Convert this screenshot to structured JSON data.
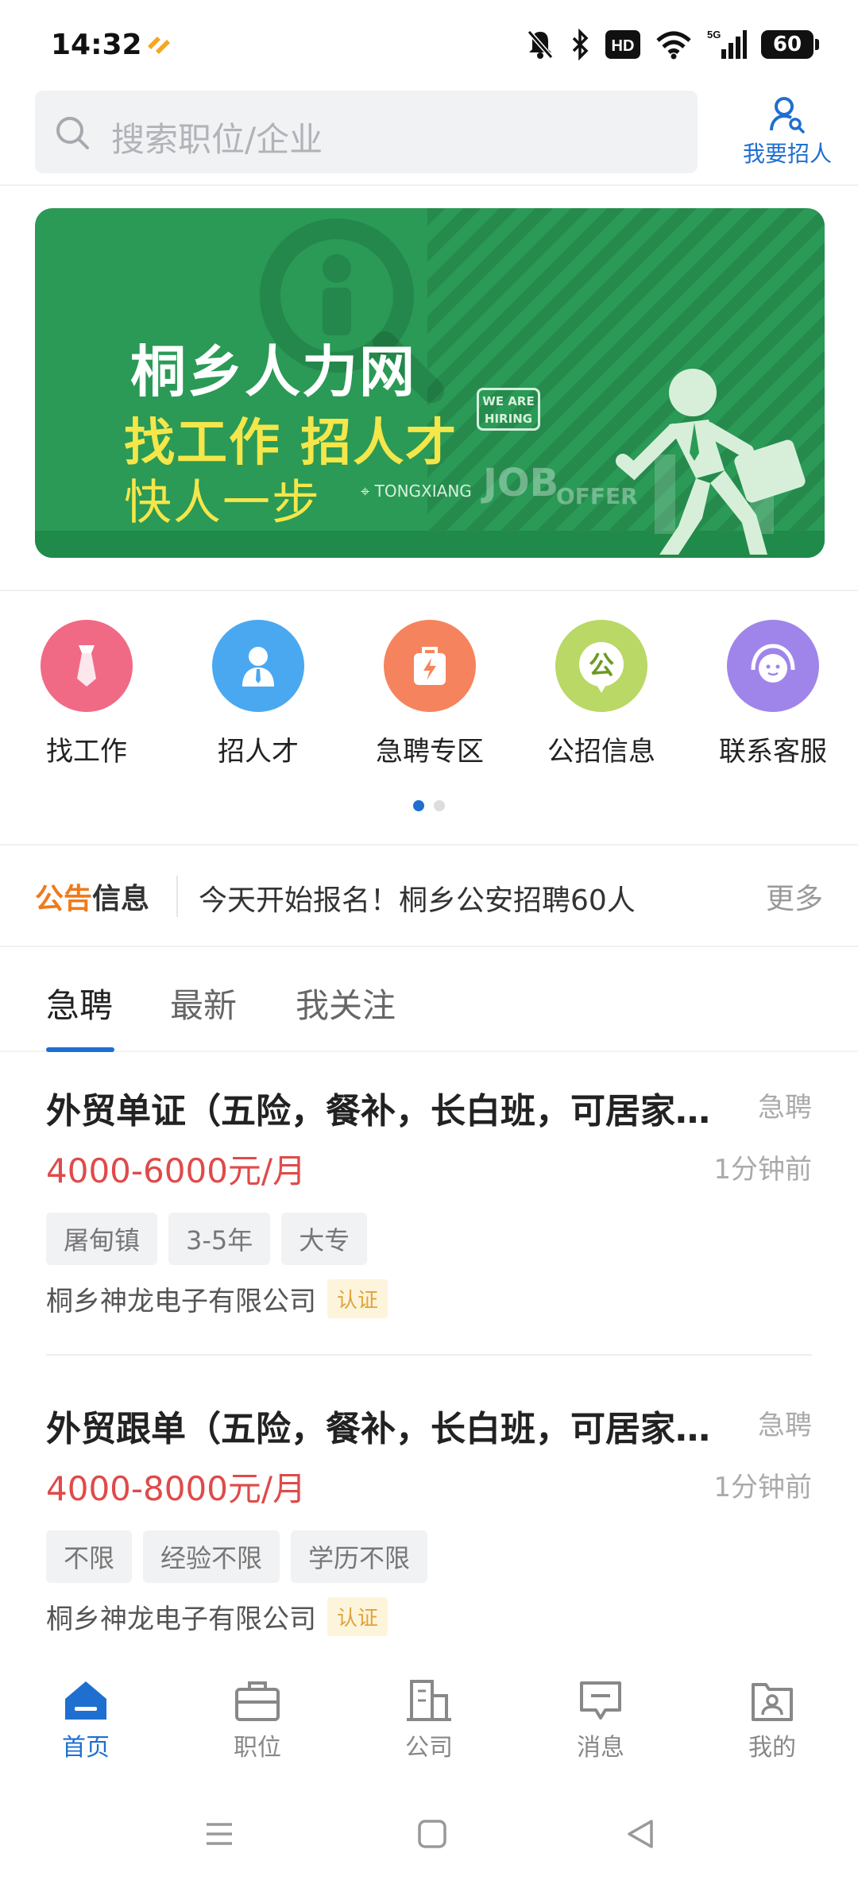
{
  "status_bar": {
    "time": "14:32",
    "battery": "60",
    "icons": [
      "app-notification-icon",
      "mute-icon",
      "bluetooth-icon",
      "hd-icon",
      "wifi-icon",
      "signal-5g-icon",
      "battery-icon"
    ]
  },
  "search": {
    "placeholder": "搜索职位/企业",
    "recruit_label": "我要招人"
  },
  "banner": {
    "title": "桐乡人力网",
    "line2": "找工作  招人才",
    "line3": "快人一步",
    "location_tag": "TONGXIANG",
    "hiring_tag_line1": "WE ARE",
    "hiring_tag_line2": "HIRING",
    "job_word": "JOB",
    "offer_word": "OFFER"
  },
  "quick_menu": [
    {
      "label": "找工作",
      "icon": "tie-icon",
      "color": "#f06a85"
    },
    {
      "label": "招人才",
      "icon": "person-icon",
      "color": "#4aa8f0"
    },
    {
      "label": "急聘专区",
      "icon": "lightning-bag-icon",
      "color": "#f5845e"
    },
    {
      "label": "公招信息",
      "icon": "public-icon",
      "color": "#b9d865"
    },
    {
      "label": "联系客服",
      "icon": "customer-service-icon",
      "color": "#9f85ea"
    }
  ],
  "notice": {
    "logo_part1": "公告",
    "logo_part2": "信息",
    "text": "今天开始报名！桐乡公安招聘60人",
    "more": "更多"
  },
  "tabs": [
    "急聘",
    "最新",
    "我关注"
  ],
  "jobs": [
    {
      "title": "外贸单证（五险，餐补，长白班，可居家…",
      "badge": "急聘",
      "salary": "4000-6000元/月",
      "time": "1分钟前",
      "tags": [
        "屠甸镇",
        "3-5年",
        "大专"
      ],
      "company": "桐乡神龙电子有限公司",
      "verified": "认证"
    },
    {
      "title": "外贸跟单（五险，餐补，长白班，可居家…",
      "badge": "急聘",
      "salary": "4000-8000元/月",
      "time": "1分钟前",
      "tags": [
        "不限",
        "经验不限",
        "学历不限"
      ],
      "company": "桐乡神龙电子有限公司",
      "verified": "认证"
    }
  ],
  "bottom_nav": [
    {
      "label": "首页",
      "icon": "home-icon",
      "active": true
    },
    {
      "label": "职位",
      "icon": "briefcase-icon",
      "active": false
    },
    {
      "label": "公司",
      "icon": "building-icon",
      "active": false
    },
    {
      "label": "消息",
      "icon": "message-icon",
      "active": false
    },
    {
      "label": "我的",
      "icon": "profile-icon",
      "active": false
    }
  ],
  "colors": {
    "accent": "#1f6fd1",
    "salary": "#e04a4a",
    "banner_green": "#2a9a56",
    "banner_yellow": "#f5e64a"
  }
}
